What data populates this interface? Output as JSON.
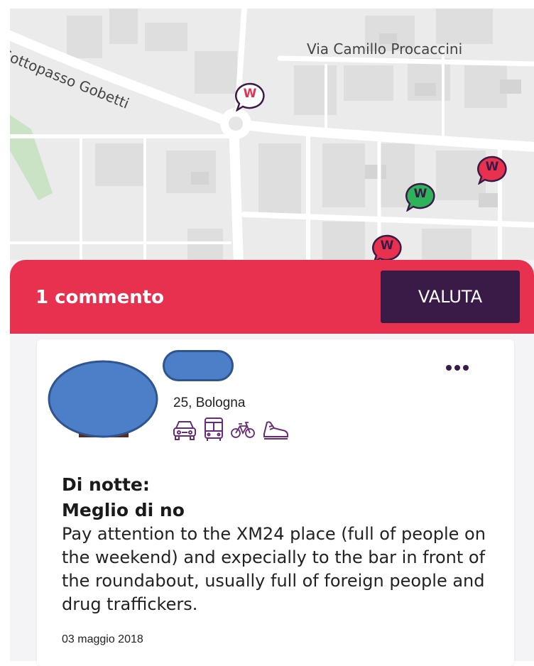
{
  "map": {
    "street_gobetti": "Sottopasso Gobetti",
    "street_procaccini": "Via Camillo Procaccini",
    "pins": [
      {
        "label": "W",
        "status": "neutral",
        "color": "#ffffff",
        "accent": "#3a1a47"
      },
      {
        "label": "W",
        "status": "negative",
        "color": "#e8314f",
        "accent": "#3a1a47"
      },
      {
        "label": "W",
        "status": "positive",
        "color": "#2fb35a",
        "accent": "#3a1a47"
      },
      {
        "label": "W",
        "status": "negative",
        "color": "#e8314f",
        "accent": "#3a1a47"
      }
    ]
  },
  "sheet": {
    "comment_count": "1 commento",
    "rate_button": "VALUTA"
  },
  "comment": {
    "user_meta": "25, Bologna",
    "transport_icons": [
      "car-icon",
      "bus-icon",
      "bicycle-icon",
      "shoe-icon"
    ],
    "title_line1": "Di notte:",
    "title_line2": "Meglio di no",
    "body": "Pay attention to the XM24 place (full of people on the weekend) and expecially to the bar in front of the roundabout, usually full of foreign people and drug traffickers.",
    "date": "03 maggio 2018"
  },
  "colors": {
    "accent_red": "#e8314f",
    "accent_dark": "#3a1a47",
    "positive_green": "#2fb35a",
    "redact_blue": "#4d7fc8"
  }
}
